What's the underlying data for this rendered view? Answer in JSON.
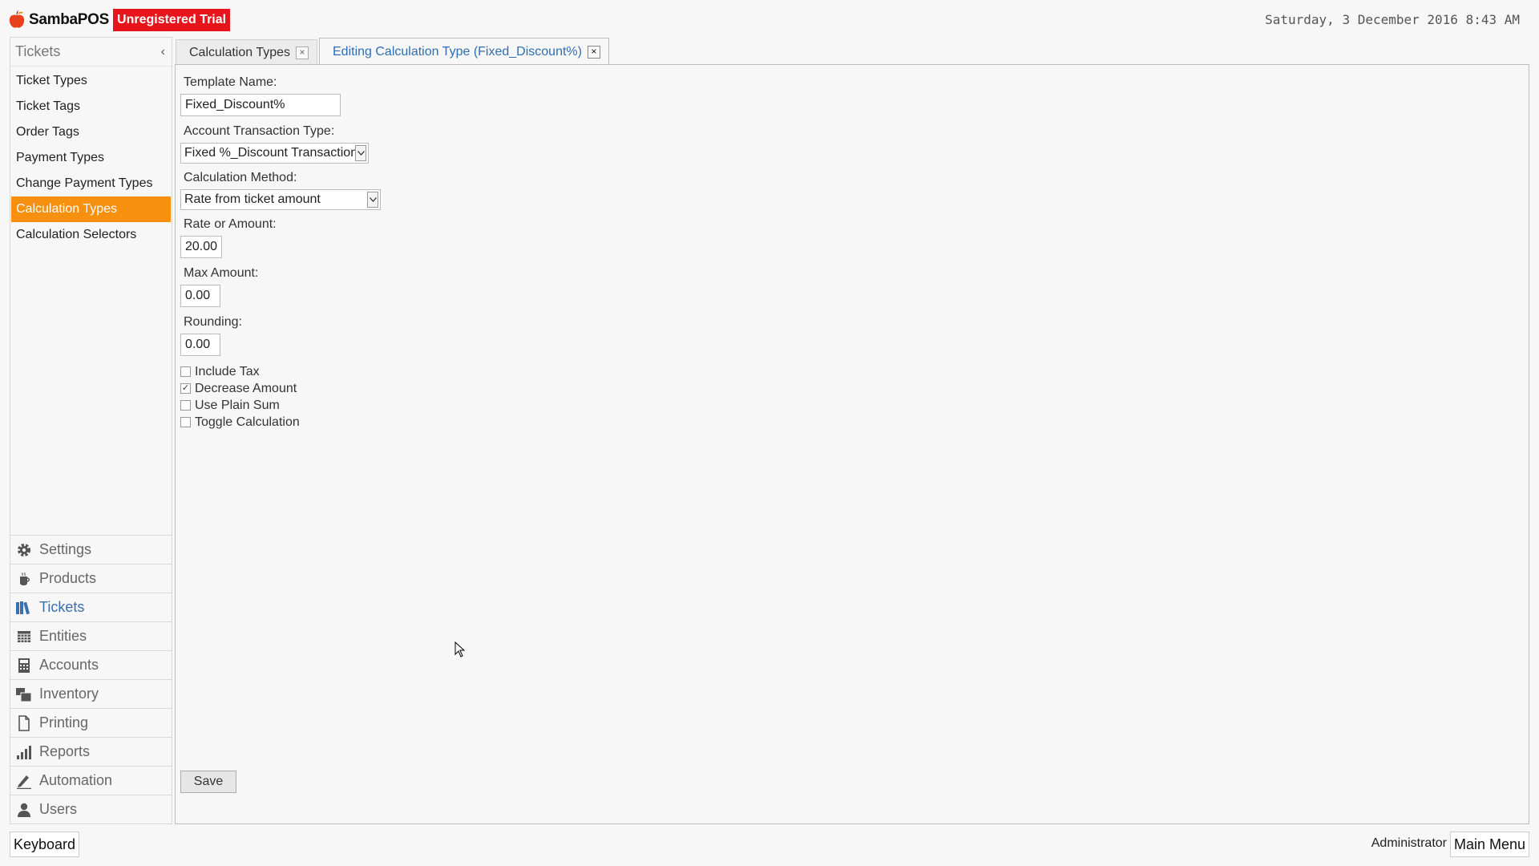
{
  "app": {
    "brand": "SambaPOS",
    "trial_badge": "Unregistered Trial",
    "datetime": "Saturday, 3 December 2016 8:43 AM",
    "accent_color": "#f7900f",
    "trial_color": "#e8141b"
  },
  "sidebar": {
    "title": "Tickets",
    "collapse_icon": "chevron-left-icon",
    "items": [
      {
        "label": "Ticket Types"
      },
      {
        "label": "Ticket Tags"
      },
      {
        "label": "Order Tags"
      },
      {
        "label": "Payment Types"
      },
      {
        "label": "Change Payment Types"
      },
      {
        "label": "Calculation Types",
        "active": true
      },
      {
        "label": "Calculation Selectors"
      }
    ]
  },
  "modules": [
    {
      "label": "Settings",
      "icon": "gear-icon"
    },
    {
      "label": "Products",
      "icon": "coffee-cup-icon"
    },
    {
      "label": "Tickets",
      "icon": "books-icon",
      "active": true
    },
    {
      "label": "Entities",
      "icon": "table-icon"
    },
    {
      "label": "Accounts",
      "icon": "calculator-icon"
    },
    {
      "label": "Inventory",
      "icon": "boxes-icon"
    },
    {
      "label": "Printing",
      "icon": "document-icon"
    },
    {
      "label": "Reports",
      "icon": "bar-chart-icon"
    },
    {
      "label": "Automation",
      "icon": "pencil-icon"
    },
    {
      "label": "Users",
      "icon": "user-icon"
    }
  ],
  "tabs": [
    {
      "label": "Calculation Types",
      "close": "×"
    },
    {
      "label": "Editing Calculation Type (Fixed_Discount%)",
      "close": "×",
      "active": true
    }
  ],
  "form": {
    "template_name_label": "Template Name:",
    "template_name_value": "Fixed_Discount%",
    "account_transaction_type_label": "Account Transaction Type:",
    "account_transaction_type_value": "Fixed %_Discount Transaction",
    "calculation_method_label": "Calculation Method:",
    "calculation_method_value": "Rate from ticket amount",
    "rate_label": "Rate or Amount:",
    "rate_value": "20.00",
    "max_amount_label": "Max Amount:",
    "max_amount_value": "0.00",
    "rounding_label": "Rounding:",
    "rounding_value": "0.00",
    "checks": [
      {
        "label": "Include Tax",
        "checked": false
      },
      {
        "label": "Decrease Amount",
        "checked": true
      },
      {
        "label": "Use Plain Sum",
        "checked": false
      },
      {
        "label": "Toggle Calculation",
        "checked": false
      }
    ],
    "save_label": "Save"
  },
  "footer": {
    "keyboard_label": "Keyboard",
    "user_label": "Administrator",
    "main_menu_label": "Main Menu"
  }
}
